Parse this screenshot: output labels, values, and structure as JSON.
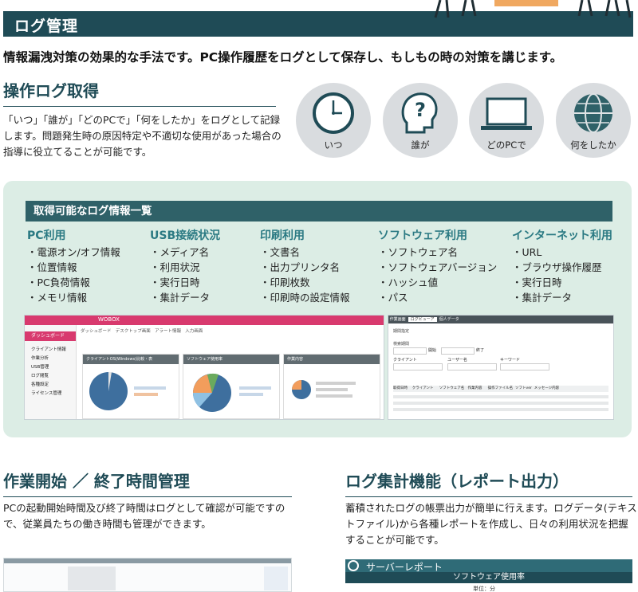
{
  "banner": {
    "title": "ログ管理"
  },
  "lead": "情報漏洩対策の効果的な手法です。PC操作履歴をログとして保存し、もしもの時の対策を講じます。",
  "section1": {
    "title": "操作ログ取得",
    "text": "「いつ」「誰が」「どのPCで」「何をしたか」をログとして記録します。問題発生時の原因特定や不適切な使用があった場合の指導に役立てることが可能です。",
    "circles": [
      {
        "label": "いつ",
        "icon": "clock-icon"
      },
      {
        "label": "誰が",
        "icon": "person-question-icon"
      },
      {
        "label": "どのPCで",
        "icon": "laptop-icon"
      },
      {
        "label": "何をしたか",
        "icon": "globe-icon"
      }
    ]
  },
  "panel": {
    "title": "取得可能なログ情報一覧",
    "categories": [
      {
        "title": "PC利用",
        "items": [
          "・電源オン/オフ情報",
          "・位置情報",
          "・PC負荷情報",
          "・メモリ情報"
        ]
      },
      {
        "title": "USB接続状況",
        "items": [
          "・メディア名",
          "・利用状況",
          "・実行日時",
          "・集計データ"
        ]
      },
      {
        "title": "印刷利用",
        "items": [
          "・文書名",
          "・出力プリンタ名",
          "・印刷枚数",
          "・印刷時の設定情報"
        ]
      },
      {
        "title": "ソフトウェア利用",
        "items": [
          "・ソフトウェア名",
          "・ソフトウェアバージョン",
          "・ハッシュ値",
          "・パス"
        ]
      },
      {
        "title": "インターネット利用",
        "items": [
          "・URL",
          "・ブラウザ操作履歴",
          "・実行日時",
          "・集計データ"
        ]
      }
    ],
    "dashboard": {
      "brand": "WOBOX",
      "tabs": [
        "ダッシュボード",
        "デスクトップ画面",
        "アラート情報",
        "入力画面"
      ],
      "sidebar": [
        "ダッシュボード",
        "クライアント情報",
        "作業分析",
        "USB管理",
        "ログ閲覧",
        "各種設定",
        "ライセンス管理"
      ],
      "cards": [
        "クライアントOS(Windows)比較・表",
        "ソフトウェア使用率",
        "作業内容"
      ]
    },
    "logview": {
      "tabs": [
        "作業画面",
        "ログビューア",
        "個人データ"
      ],
      "labels": [
        "期間指定",
        "検索期間",
        "開始",
        "終了",
        "クライアント",
        "ユーザー名",
        "キーワード"
      ],
      "columns": [
        "取得日時",
        "クライアント",
        "ソフトウェア名",
        "作業内容",
        "操作ファイル名",
        "ソフトver",
        "メッセージ内容"
      ]
    }
  },
  "section2": {
    "title": "作業開始 ／ 終了時間管理",
    "text": "PCの起動開始時間及び終了時間はログとして確認が可能ですので、従業員たちの働き時間も管理ができます。"
  },
  "section3": {
    "title": "ログ集計機能（レポート出力）",
    "text": "蓄積されたログの帳票出力が簡単に行えます。ログデータ(テキストファイル)から各種レポートを作成し、日々の利用状況を把握することが可能です。",
    "report_title": "サーバーレポート",
    "report_subtitle": "ソフトウェア使用率",
    "report_unit": "単位：分"
  },
  "colors": {
    "primary": "#1f4b56",
    "accent": "#2b7a83",
    "panel_bg": "#dcede5",
    "dashboard_header": "#d83a6e"
  }
}
